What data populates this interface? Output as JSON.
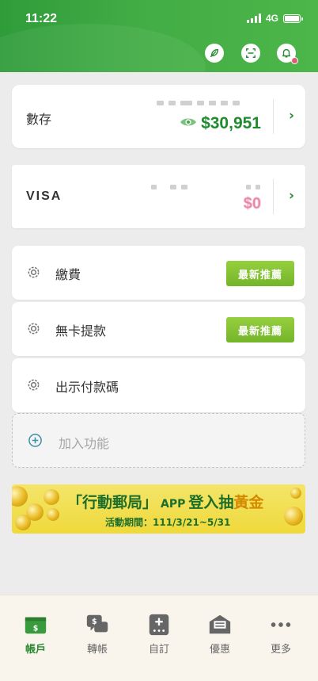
{
  "status_bar": {
    "time": "11:22",
    "network": "4G"
  },
  "header": {
    "icons": [
      "feather-icon",
      "scan-icon",
      "bell-icon"
    ]
  },
  "accounts": [
    {
      "label": "數存",
      "balance": "$30,951",
      "balance_visible": true
    },
    {
      "label": "VISA",
      "balance": "$0"
    }
  ],
  "features": [
    {
      "label": "繳費",
      "badge": "最新推薦"
    },
    {
      "label": "無卡提款",
      "badge": "最新推薦"
    },
    {
      "label": "出示付款碼"
    }
  ],
  "add_feature": {
    "label": "加入功能"
  },
  "banner": {
    "title_prefix": "「行動郵局」",
    "title_app": "APP",
    "title_mid": "登入抽",
    "title_gold": "黃金",
    "period": "活動期間：111/3/21~5/31"
  },
  "tabs": [
    {
      "label": "帳戶",
      "icon": "account-icon",
      "active": true
    },
    {
      "label": "轉帳",
      "icon": "transfer-icon"
    },
    {
      "label": "自訂",
      "icon": "custom-icon"
    },
    {
      "label": "優惠",
      "icon": "offers-icon"
    },
    {
      "label": "更多",
      "icon": "more-icon"
    }
  ],
  "colors": {
    "brand_green": "#43ad45",
    "balance_green": "#1f8a2e",
    "badge_green": "#74b52a",
    "visa_pink": "#e87ca4"
  }
}
